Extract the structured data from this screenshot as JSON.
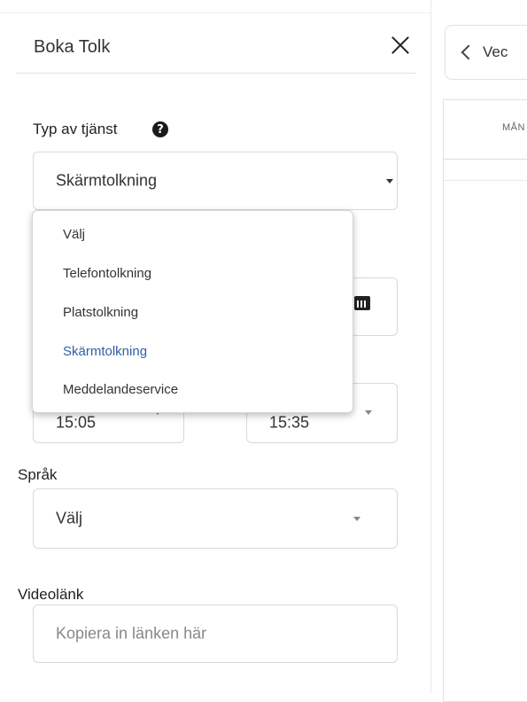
{
  "dialog": {
    "title": "Boka Tolk",
    "service": {
      "label": "Typ av tjänst",
      "selected": "Skärmtolkning",
      "options": [
        "Välj",
        "Telefontolkning",
        "Platstolkning",
        "Skärmtolkning",
        "Meddelandeservice"
      ],
      "highlighted_index": 3,
      "highlight_color": "#2f5fa8"
    },
    "time": {
      "start": "15:05",
      "end": "15:35"
    },
    "language": {
      "label": "Språk",
      "selected": "Välj"
    },
    "video": {
      "label": "Videolänk",
      "placeholder": "Kopiera in länken här"
    }
  },
  "calendar": {
    "week_label": "Vec",
    "day_header": "MÅN"
  }
}
